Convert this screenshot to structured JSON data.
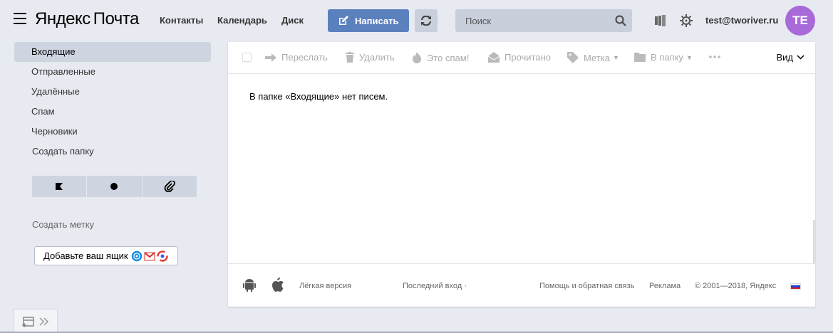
{
  "header": {
    "logo_brand": "Яндекс",
    "logo_product": "Почта",
    "nav": [
      "Контакты",
      "Календарь",
      "Диск"
    ],
    "compose_label": "Написать",
    "search_placeholder": "Поиск",
    "user_email": "test@tworiver.ru",
    "avatar_initials": "TE"
  },
  "sidebar": {
    "folders": [
      "Входящие",
      "Отправленные",
      "Удалённые",
      "Спам",
      "Черновики"
    ],
    "active_folder": "Входящие",
    "create_folder": "Создать папку",
    "create_label": "Создать метку",
    "add_mailbox": "Добавьте ваш ящик"
  },
  "toolbar": {
    "forward": "Переслать",
    "delete": "Удалить",
    "spam": "Это спам!",
    "read": "Прочитано",
    "label": "Метка",
    "to_folder": "В папку",
    "view": "Вид"
  },
  "content": {
    "empty_message": "В папке «Входящие» нет писем."
  },
  "footer": {
    "light_version": "Лёгкая версия",
    "last_login": "Последний вход ·",
    "help": "Помощь и обратная связь",
    "ads": "Реклама",
    "copyright": "© 2001—2018, Яндекс"
  },
  "colors": {
    "compose": "#5b80be",
    "avatar": "#a76ad8",
    "background": "#e7eaf0"
  }
}
